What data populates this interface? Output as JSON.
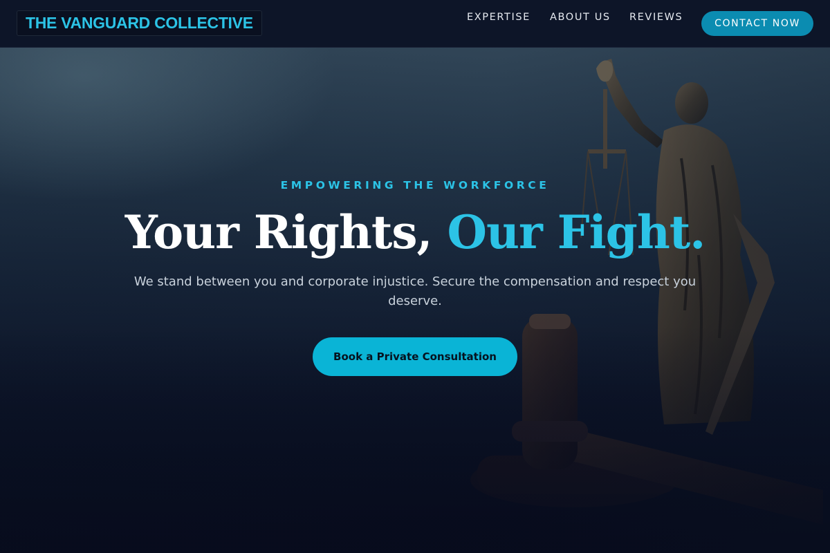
{
  "brand": {
    "name": "THE VANGUARD COLLECTIVE"
  },
  "nav": {
    "links": [
      {
        "label": "EXPERTISE"
      },
      {
        "label": "ABOUT US"
      },
      {
        "label": "REVIEWS"
      }
    ],
    "contact_label": "CONTACT NOW"
  },
  "hero": {
    "eyebrow": "EMPOWERING THE WORKFORCE",
    "headline_main": "Your Rights, ",
    "headline_accent": "Our Fight.",
    "subtext": "We stand between you and corporate injustice. Secure the compensation and respect you deserve.",
    "cta_label": "Book a Private Consultation"
  },
  "colors": {
    "accent": "#2cc3e6",
    "cta": "#0ab4d6",
    "contact_button": "#0b8cb1",
    "navbar": "#0d1528",
    "background": "#070b1c"
  },
  "icons": {
    "background_image": "lady-justice-statue-and-gavel"
  }
}
